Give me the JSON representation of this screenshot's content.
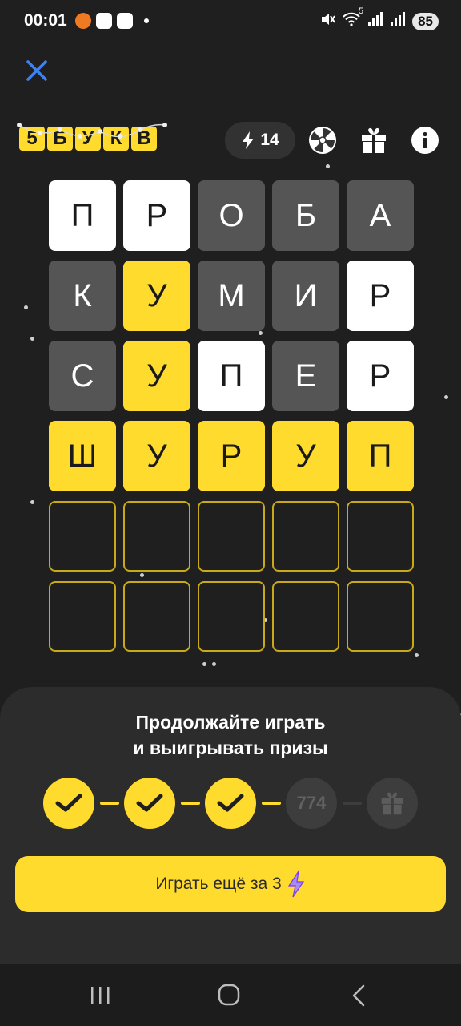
{
  "status_bar": {
    "time": "00:01",
    "signal_text": "5",
    "battery": "85"
  },
  "header": {
    "logo_letters": [
      "5",
      "Б",
      "У",
      "К",
      "В"
    ],
    "energy_count": "14"
  },
  "grid": {
    "rows": [
      [
        {
          "letter": "П",
          "state": "white"
        },
        {
          "letter": "Р",
          "state": "white"
        },
        {
          "letter": "О",
          "state": "gray"
        },
        {
          "letter": "Б",
          "state": "gray"
        },
        {
          "letter": "А",
          "state": "gray"
        }
      ],
      [
        {
          "letter": "К",
          "state": "gray"
        },
        {
          "letter": "У",
          "state": "yellow"
        },
        {
          "letter": "М",
          "state": "gray"
        },
        {
          "letter": "И",
          "state": "gray"
        },
        {
          "letter": "Р",
          "state": "white"
        }
      ],
      [
        {
          "letter": "С",
          "state": "gray"
        },
        {
          "letter": "У",
          "state": "yellow"
        },
        {
          "letter": "П",
          "state": "white"
        },
        {
          "letter": "Е",
          "state": "gray"
        },
        {
          "letter": "Р",
          "state": "white"
        }
      ],
      [
        {
          "letter": "Ш",
          "state": "yellow"
        },
        {
          "letter": "У",
          "state": "yellow"
        },
        {
          "letter": "Р",
          "state": "yellow"
        },
        {
          "letter": "У",
          "state": "yellow"
        },
        {
          "letter": "П",
          "state": "yellow"
        }
      ],
      [
        {
          "letter": "",
          "state": "empty"
        },
        {
          "letter": "",
          "state": "empty"
        },
        {
          "letter": "",
          "state": "empty"
        },
        {
          "letter": "",
          "state": "empty"
        },
        {
          "letter": "",
          "state": "empty"
        }
      ],
      [
        {
          "letter": "",
          "state": "empty"
        },
        {
          "letter": "",
          "state": "empty"
        },
        {
          "letter": "",
          "state": "empty"
        },
        {
          "letter": "",
          "state": "empty"
        },
        {
          "letter": "",
          "state": "empty"
        }
      ]
    ]
  },
  "sheet": {
    "title_line1": "Продолжайте играть",
    "title_line2": "и выигрывать призы",
    "progress": {
      "completed_steps": 3,
      "pending_value": "774",
      "final_reward_icon": "gift-icon"
    },
    "play_button_label": "Играть ещё за 3"
  },
  "icons": {
    "close": "close-icon",
    "energy": "lightning-icon",
    "wheel": "fortune-wheel-icon",
    "gift": "gift-icon",
    "info": "info-icon"
  },
  "colors": {
    "background": "#1f1f1f",
    "accent_yellow": "#ffdb2e",
    "tile_gray": "#555555",
    "tile_white": "#ffffff",
    "close_blue": "#3b82f6"
  }
}
